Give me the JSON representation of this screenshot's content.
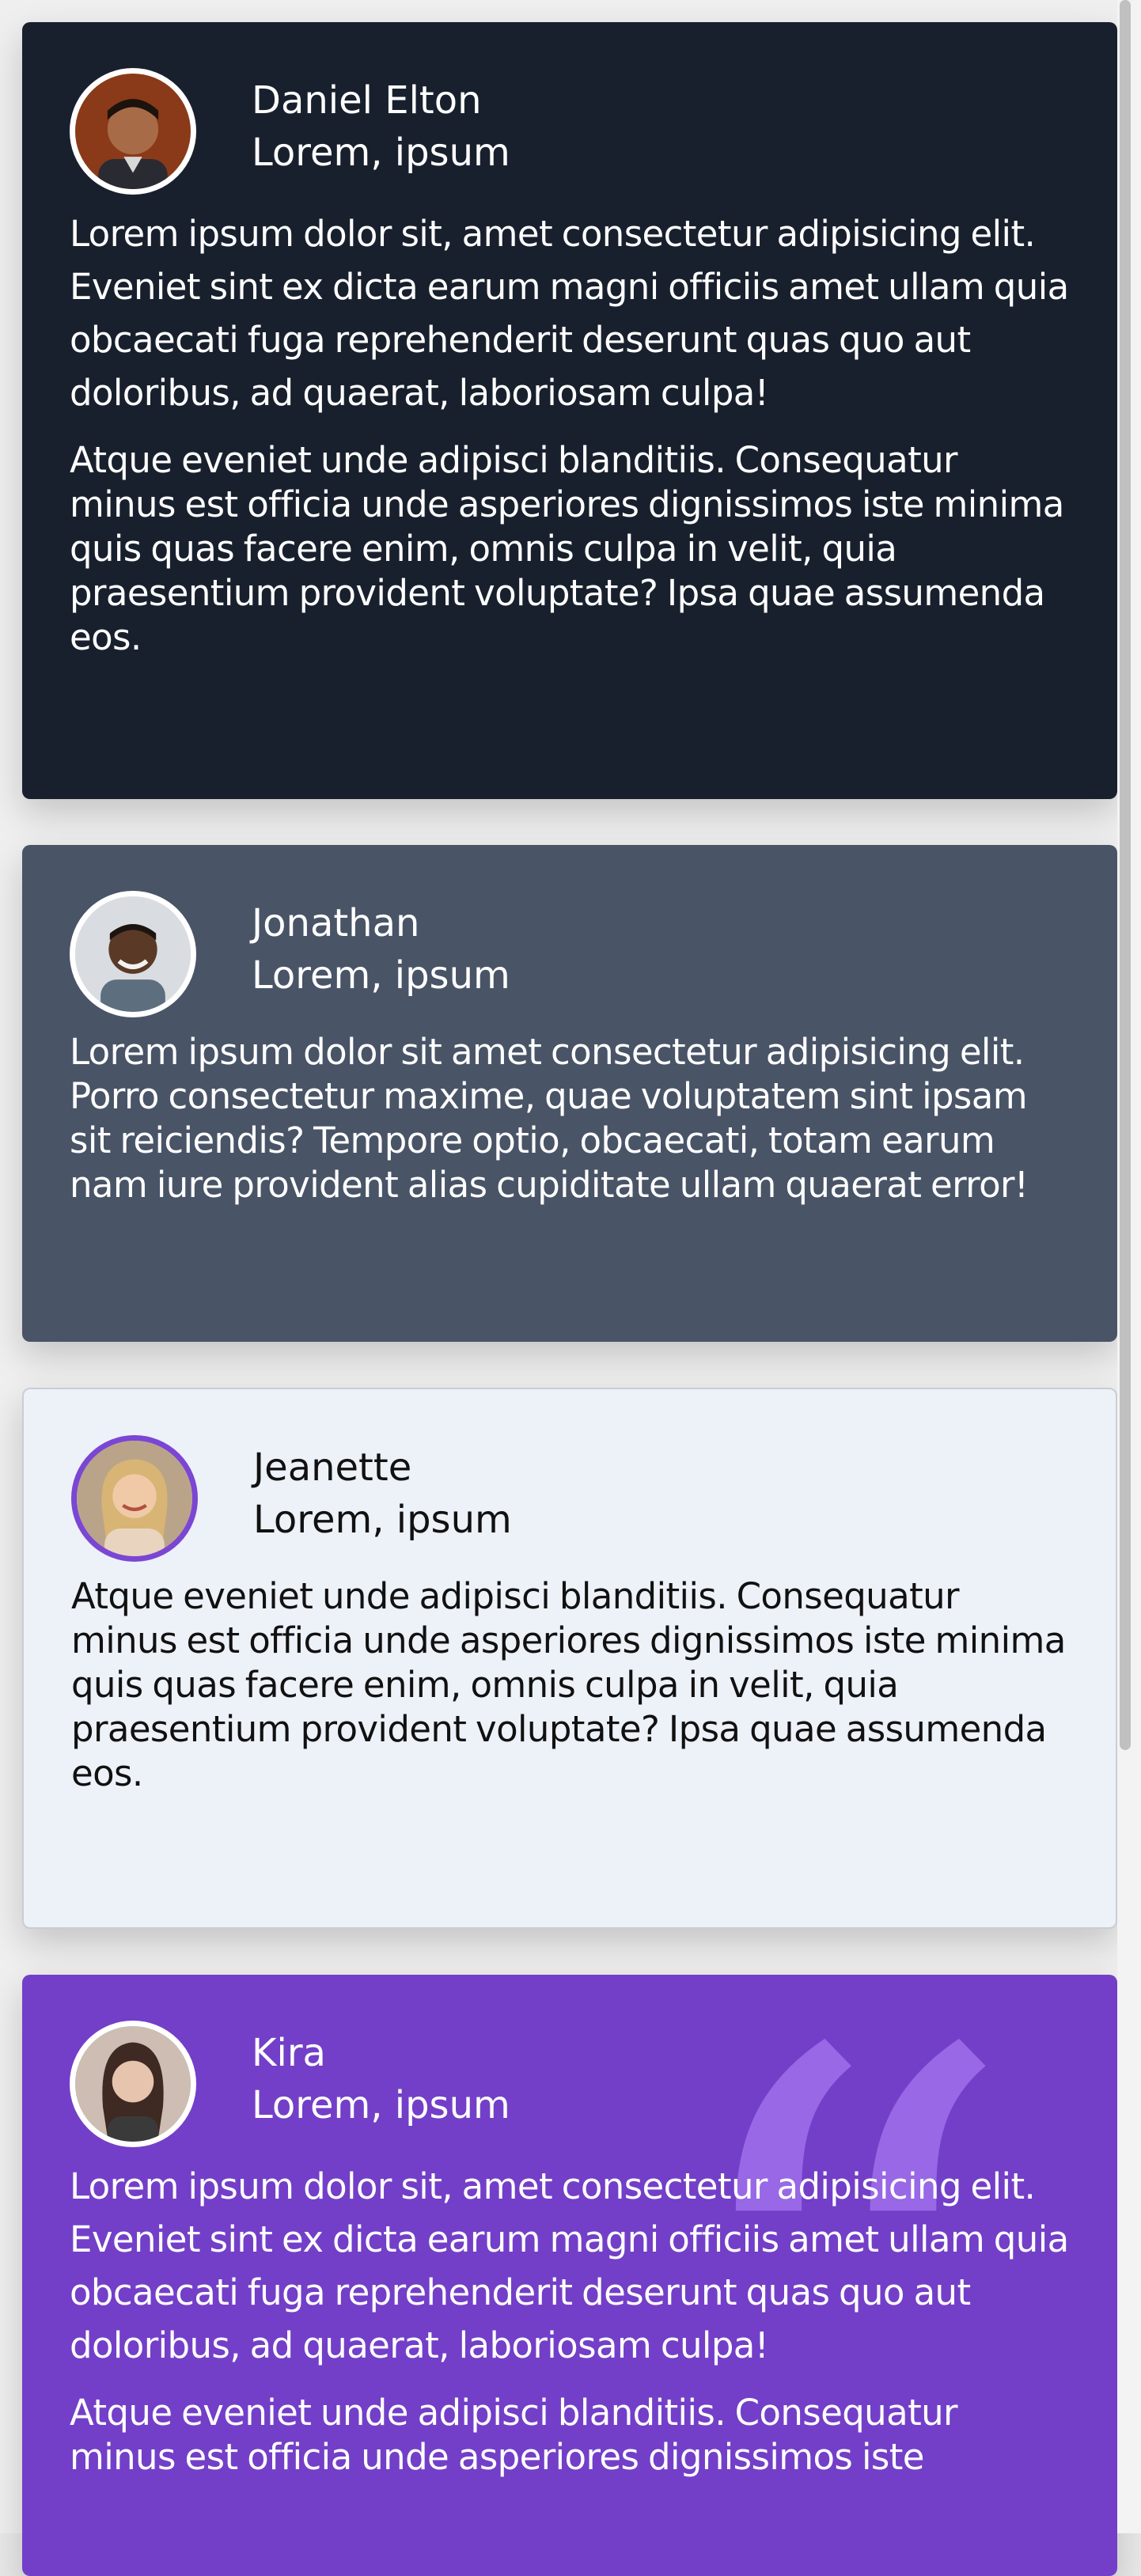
{
  "cards": [
    {
      "name": "Daniel Elton",
      "role": "Lorem, ipsum",
      "paragraphs": [
        "Lorem ipsum dolor sit, amet consectetur adipisicing elit. Eveniet sint ex dicta earum magni officiis amet ullam quia obcaecati fuga reprehenderit deserunt quas quo aut doloribus, ad quaerat, laboriosam culpa!",
        "Atque eveniet unde adipisci blanditiis. Consequatur minus est officia unde asperiores dignissimos iste minima quis quas facere enim, omnis culpa in velit, quia praesentium provident voluptate? Ipsa quae assumenda eos."
      ]
    },
    {
      "name": "Jonathan",
      "role": "Lorem, ipsum",
      "paragraphs": [
        "Lorem ipsum dolor sit amet consectetur adipisicing elit. Porro consectetur maxime, quae voluptatem sint ipsam sit reiciendis? Tempore optio, obcaecati, totam earum nam iure provident alias cupiditate ullam quaerat error!"
      ]
    },
    {
      "name": "Jeanette",
      "role": "Lorem, ipsum",
      "paragraphs": [
        "Atque eveniet unde adipisci blanditiis. Consequatur minus est officia unde asperiores dignissimos iste minima quis quas facere enim, omnis culpa in velit, quia praesentium provident voluptate? Ipsa quae assumenda eos."
      ]
    },
    {
      "name": "Kira",
      "role": "Lorem, ipsum",
      "paragraphs": [
        "Lorem ipsum dolor sit, amet consectetur adipisicing elit. Eveniet sint ex dicta earum magni officiis amet ullam quia obcaecati fuga reprehenderit deserunt quas quo aut doloribus, ad quaerat, laboriosam culpa!",
        "Atque eveniet unde adipisci blanditiis. Consequatur minus est officia unde asperiores dignissimos iste"
      ]
    }
  ],
  "decor": {
    "quote_glyph": "“"
  },
  "colors": {
    "dark": "#19202d",
    "slate": "#495467",
    "light": "#edf1f8",
    "purple": "#733fc8"
  }
}
